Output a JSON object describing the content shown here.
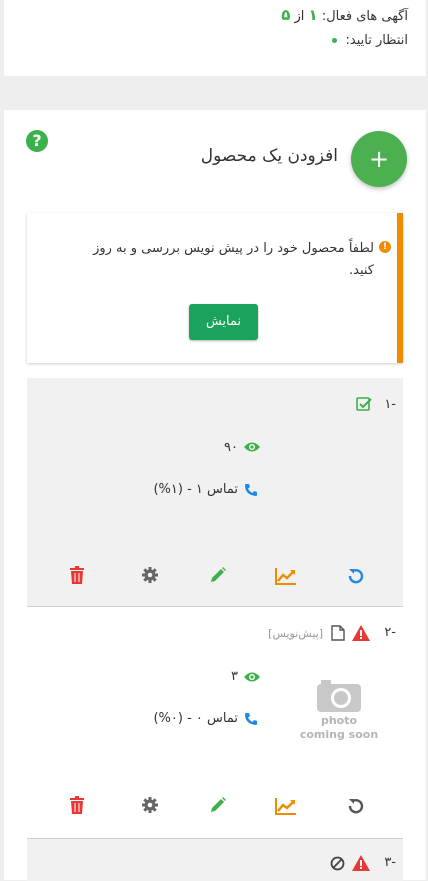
{
  "stats": {
    "active_label": "آگهی های فعال:",
    "active_count": "۱",
    "of_label": "از",
    "active_total": "۵",
    "pending_label": "انتظار تایید:"
  },
  "add_product": {
    "title": "افزودن یک محصول",
    "fab_label": "+",
    "help_label": "?"
  },
  "notice": {
    "message": "لطفاً محصول خود را در پیش نویس بررسی و به روز کنید.",
    "button_label": "نمایش"
  },
  "items": [
    {
      "number": "-۱",
      "views": "۹۰",
      "contacts": "تماس ۱ - (۱%)"
    },
    {
      "number": "-۲",
      "draft_label": "[پیش‌نویس]",
      "views": "۳",
      "contacts": "تماس ۰ - (۰%)",
      "photo_line1": "photo",
      "photo_line2": "coming soon"
    },
    {
      "number": "-۳"
    }
  ],
  "colors": {
    "green": "#3cb04a",
    "orange": "#f08c00",
    "blue": "#1e88e5",
    "red": "#e53935",
    "gray": "#666666"
  }
}
